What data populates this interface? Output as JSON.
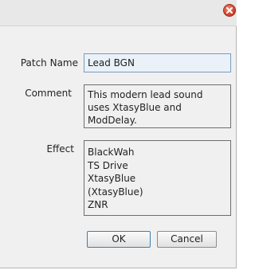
{
  "dialog": {
    "labels": {
      "patch_name": "Patch Name",
      "comment": "Comment",
      "effect": "Effect"
    },
    "patch_name_value": "Lead BGN",
    "comment_value": "This modern lead sound uses XtasyBlue and ModDelay.",
    "effects": [
      "BlackWah",
      "TS Drive",
      "XtasyBlue",
      "(XtasyBlue)",
      "ZNR"
    ],
    "buttons": {
      "ok": "OK",
      "cancel": "Cancel"
    },
    "close_icon": "close-icon",
    "colors": {
      "close_button": "#d64a33",
      "focused_field_border": "#7a9bc0",
      "focused_field_bg": "#eaf1f8"
    }
  }
}
